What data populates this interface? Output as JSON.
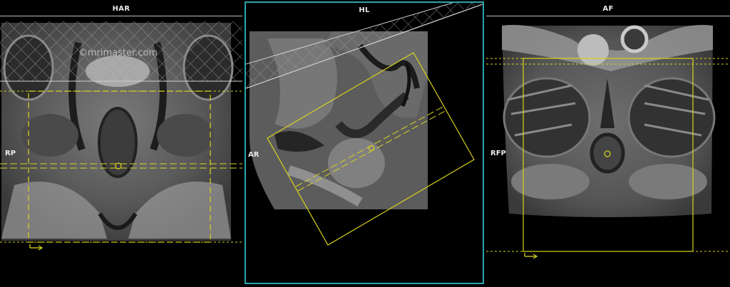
{
  "viewports": {
    "left": {
      "orientation_top": "HAR",
      "orientation_left": "RP",
      "watermark": "©mrimaster.com"
    },
    "middle": {
      "orientation_top": "HL",
      "orientation_left": "AR"
    },
    "right": {
      "orientation_top": "AF",
      "orientation_left": "RFP"
    }
  },
  "colors": {
    "active_border": "#2aa6ad",
    "planning_box": "#d8d21e",
    "label_text": "#e8e8e8"
  },
  "icons": {
    "left_direction": "arrow-right-icon",
    "right_direction": "arrow-right-icon"
  }
}
